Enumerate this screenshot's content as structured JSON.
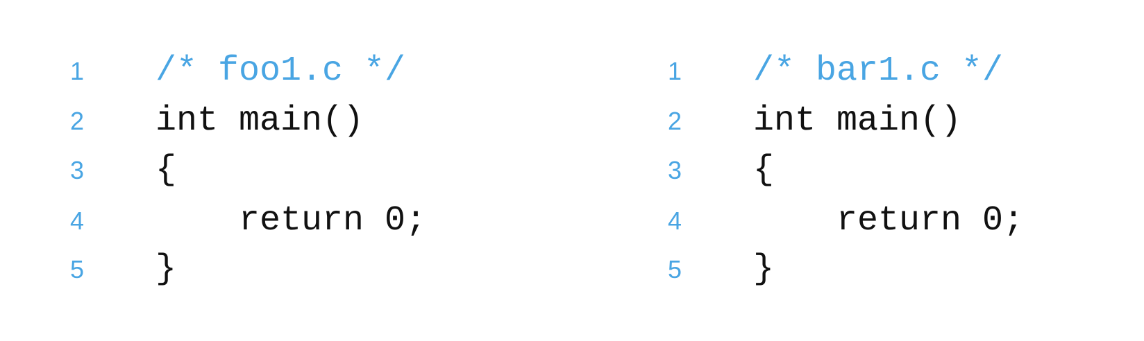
{
  "listings": [
    {
      "lines": [
        {
          "number": "1",
          "text": "/* foo1.c */"
        },
        {
          "number": "2",
          "text": "int main()"
        },
        {
          "number": "3",
          "text": "{"
        },
        {
          "number": "4",
          "text": "return 0;"
        },
        {
          "number": "5",
          "text": "}"
        }
      ]
    },
    {
      "lines": [
        {
          "number": "1",
          "text": "/* bar1.c */"
        },
        {
          "number": "2",
          "text": "int main()"
        },
        {
          "number": "3",
          "text": "{"
        },
        {
          "number": "4",
          "text": "return 0;"
        },
        {
          "number": "5",
          "text": "}"
        }
      ]
    }
  ],
  "colors": {
    "line_number": "#49a5e3",
    "comment": "#49a5e3",
    "code": "#111111",
    "background": "#ffffff"
  }
}
